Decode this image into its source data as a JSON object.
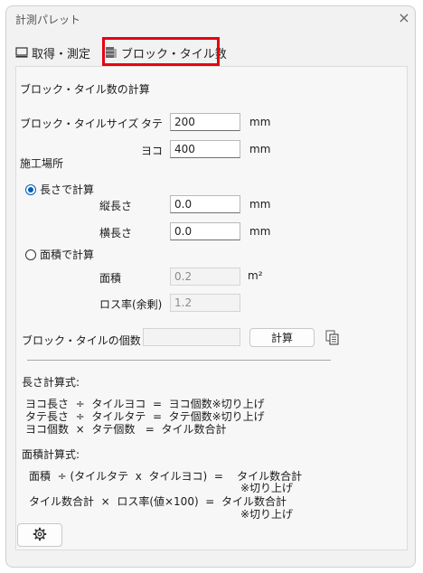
{
  "window": {
    "title": "計測パレット",
    "close": "×"
  },
  "tabs": [
    {
      "label": "取得・測定",
      "icon": "monitor-icon",
      "selected": false
    },
    {
      "label": "ブロック・タイル数",
      "icon": "block-tile-icon",
      "selected": true
    }
  ],
  "highlight_color": "#e60012",
  "section": {
    "heading": "ブロック・タイル数の計算"
  },
  "size": {
    "label": "ブロック・タイルサイズ",
    "tate_label": "タテ",
    "tate_value": "200",
    "tate_unit": "mm",
    "yoko_label": "ヨコ",
    "yoko_value": "400",
    "yoko_unit": "mm"
  },
  "site": {
    "label": "施工場所"
  },
  "by_length": {
    "label": "長さで計算",
    "checked": true,
    "vertical_label": "縦長さ",
    "vertical_value": "0.0",
    "vertical_unit": "mm",
    "horizontal_label": "横長さ",
    "horizontal_value": "0.0",
    "horizontal_unit": "mm"
  },
  "by_area": {
    "label": "面積で計算",
    "checked": false,
    "area_label": "面積",
    "area_value": "0.2",
    "area_unit": "m²",
    "loss_label": "ロス率(余剰)",
    "loss_value": "1.2"
  },
  "count": {
    "label": "ブロック・タイルの個数",
    "value": "",
    "calc_button": "計算",
    "copy_icon": "copy-icon"
  },
  "formula_length": {
    "heading": "長さ計算式:",
    "lines": [
      "ヨコ長さ  ÷  タイルヨコ  =  ヨコ個数※切り上げ",
      "タテ長さ  ÷  タイルタテ  =  タテ個数※切り上げ",
      "ヨコ個数  ×  タテ個数   =  タイル数合計"
    ]
  },
  "formula_area": {
    "heading": "面積計算式:",
    "line1": "面積  ÷ (タイルタテ  x  タイルヨコ)  =    タイル数合計",
    "line1_note": "※切り上げ",
    "line2": "タイル数合計  ×  ロス率(値×100)  =  タイル数合計",
    "line2_note": "※切り上げ"
  },
  "footer": {
    "settings_icon": "gear-icon"
  }
}
